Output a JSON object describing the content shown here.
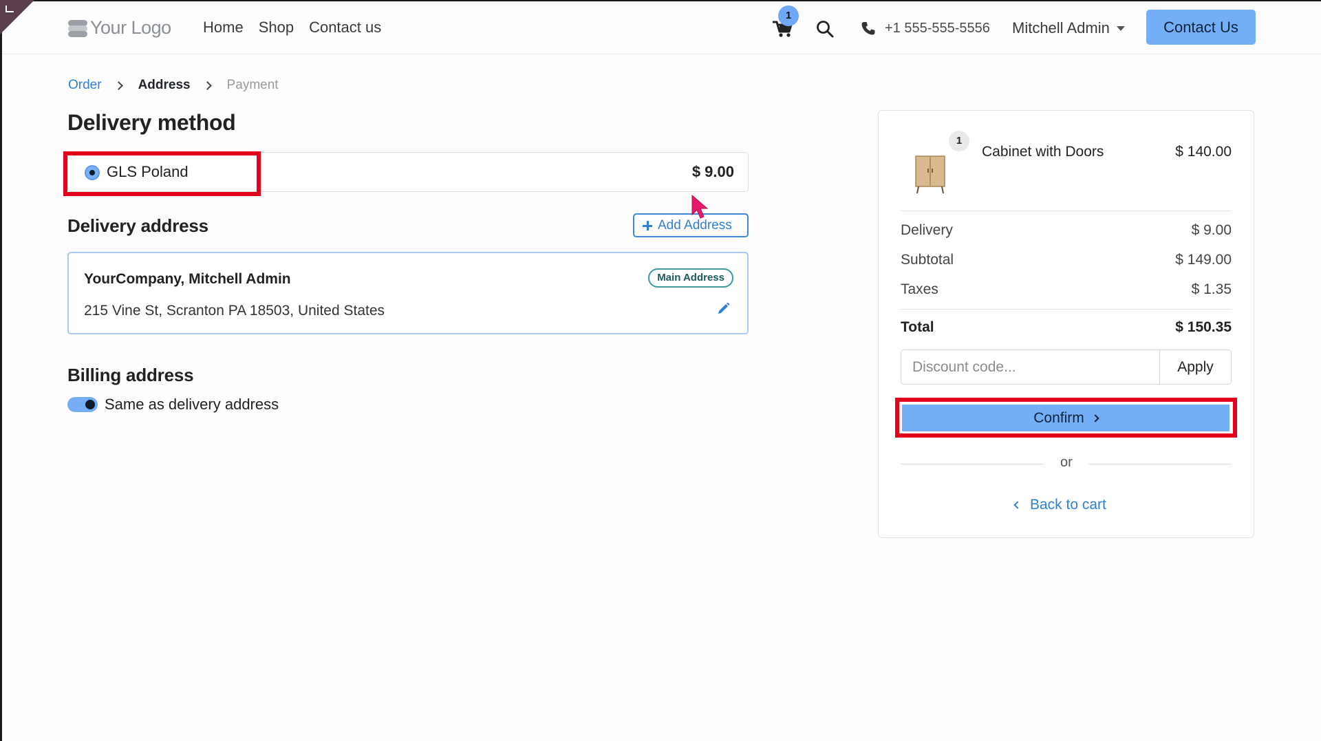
{
  "header": {
    "logo_text": "Your Logo",
    "nav": [
      {
        "label": "Home"
      },
      {
        "label": "Shop"
      },
      {
        "label": "Contact us"
      }
    ],
    "cart_count": "1",
    "phone": "+1 555-555-5556",
    "user": "Mitchell Admin",
    "contact_button": "Contact Us"
  },
  "breadcrumb": {
    "order": "Order",
    "address": "Address",
    "payment": "Payment"
  },
  "delivery_method": {
    "heading": "Delivery method",
    "option_name": "GLS Poland",
    "option_price": "$ 9.00",
    "selected": true
  },
  "delivery_address": {
    "heading": "Delivery address",
    "add_button": "Add Address",
    "name": "YourCompany, Mitchell Admin",
    "line": "215 Vine St, Scranton PA 18503, United States",
    "badge": "Main Address"
  },
  "billing": {
    "heading": "Billing address",
    "toggle_label": "Same as delivery address",
    "toggle_on": true
  },
  "summary": {
    "product": {
      "qty": "1",
      "name": "Cabinet with Doors",
      "price": "$ 140.00"
    },
    "delivery_label": "Delivery",
    "delivery_value": "$ 9.00",
    "subtotal_label": "Subtotal",
    "subtotal_value": "$ 149.00",
    "taxes_label": "Taxes",
    "taxes_value": "$ 1.35",
    "total_label": "Total",
    "total_value": "$ 150.35",
    "discount_placeholder": "Discount code...",
    "apply_label": "Apply",
    "confirm_label": "Confirm",
    "or_text": "or",
    "back_label": "Back to cart"
  },
  "colors": {
    "accent": "#74aef6",
    "link": "#2f7fd6",
    "highlight": "#e3001b"
  }
}
